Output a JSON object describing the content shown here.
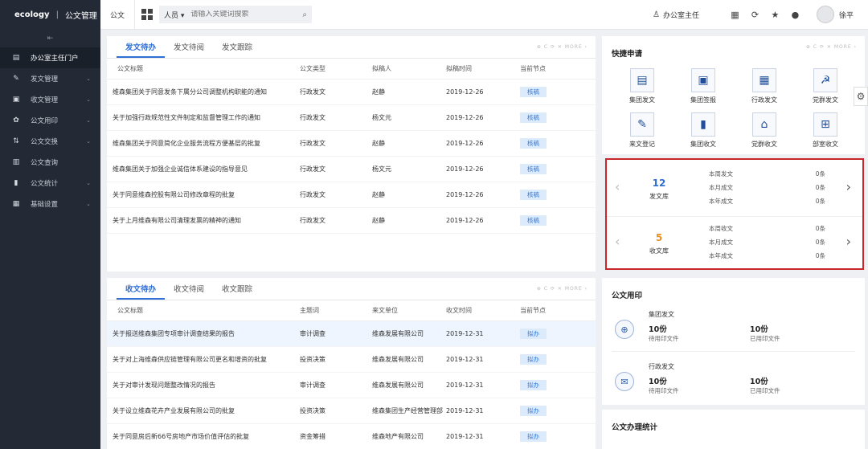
{
  "sidebar": {
    "brand": "ecology",
    "brand_sep": "|",
    "module": "公文管理",
    "collapse": "⇤",
    "items": [
      {
        "label": "办公室主任门户",
        "icon": "▤",
        "chev": "",
        "active": true
      },
      {
        "label": "发文管理",
        "icon": "✎",
        "chev": "⌄",
        "active": false
      },
      {
        "label": "收文管理",
        "icon": "▣",
        "chev": "⌄",
        "active": false
      },
      {
        "label": "公文用印",
        "icon": "✿",
        "chev": "⌄",
        "active": false
      },
      {
        "label": "公文交换",
        "icon": "⇅",
        "chev": "⌄",
        "active": false
      },
      {
        "label": "公文查询",
        "icon": "▥",
        "chev": "",
        "active": false
      },
      {
        "label": "公文统计",
        "icon": "▮",
        "chev": "⌄",
        "active": false
      },
      {
        "label": "基础设置",
        "icon": "▦",
        "chev": "⌄",
        "active": false
      }
    ]
  },
  "topbar": {
    "module": "公文",
    "search_type": "人员 ▾",
    "search_placeholder": "请输入关键词搜索",
    "search_icon": "⌕",
    "role_icon": "♙",
    "role": "办公室主任",
    "icons": [
      "▦",
      "⟳",
      "★",
      "●"
    ],
    "username": "徐平"
  },
  "tools_text": "⊕ C ⟳ ✕ MORE ›",
  "send_panel": {
    "tabs": [
      "发文待办",
      "发文待阅",
      "发文跟踪"
    ],
    "headers": [
      "公文标题",
      "公文类型",
      "拟稿人",
      "拟稿时间",
      "当前节点"
    ],
    "rows": [
      {
        "title": "维森集团关于同意发条下属分公司调整机构职能的通知",
        "type": "行政发文",
        "person": "赵静",
        "date": "2019-12-26",
        "node": "核稿"
      },
      {
        "title": "关于加强行政规范性文件制定和监督管理工作的通知",
        "type": "行政发文",
        "person": "杨文元",
        "date": "2019-12-26",
        "node": "核稿"
      },
      {
        "title": "维森集团关于同意简化企业服务流程方便基层的批复",
        "type": "行政发文",
        "person": "赵静",
        "date": "2019-12-26",
        "node": "核稿"
      },
      {
        "title": "维森集团关于加强企业诚信体系建设的指导意见",
        "type": "行政发文",
        "person": "杨文元",
        "date": "2019-12-26",
        "node": "核稿"
      },
      {
        "title": "关于同意维森控股有限公司修改章程的批复",
        "type": "行政发文",
        "person": "赵静",
        "date": "2019-12-26",
        "node": "核稿"
      },
      {
        "title": "关于上月维森有限公司清理发票的精神的通知",
        "type": "行政发文",
        "person": "赵静",
        "date": "2019-12-26",
        "node": "核稿"
      }
    ]
  },
  "recv_panel": {
    "tabs": [
      "收文待办",
      "收文待阅",
      "收文跟踪"
    ],
    "headers": [
      "公文标题",
      "主题词",
      "来文单位",
      "收文时间",
      "当前节点"
    ],
    "rows": [
      {
        "title": "关于报送维森集团专项审计调查结果的报告",
        "topic": "审计调查",
        "unit": "维森发展有限公司",
        "date": "2019-12-31",
        "node": "拟办"
      },
      {
        "title": "关于对上海维森供应链管理有限公司更名和增资的批复",
        "topic": "投资决策",
        "unit": "维森发展有限公司",
        "date": "2019-12-31",
        "node": "拟办"
      },
      {
        "title": "关于对审计发现问题整改情况的报告",
        "topic": "审计调查",
        "unit": "维森发展有限公司",
        "date": "2019-12-31",
        "node": "拟办"
      },
      {
        "title": "关于设立维森花卉产业发展有限公司的批复",
        "topic": "投资决策",
        "unit": "维森集团生产经营管理部",
        "date": "2019-12-31",
        "node": "拟办"
      },
      {
        "title": "关于同意房后新66号房地产市场价值评估的批复",
        "topic": "资金筹措",
        "unit": "维森地产有限公司",
        "date": "2019-12-31",
        "node": "拟办"
      }
    ]
  },
  "quick": {
    "title": "快捷申请",
    "items": [
      {
        "label": "集团发文",
        "icon": "▤"
      },
      {
        "label": "集团签报",
        "icon": "▣"
      },
      {
        "label": "行政发文",
        "icon": "▦"
      },
      {
        "label": "党群发文",
        "icon": "☭"
      },
      {
        "label": "来文登记",
        "icon": "✎"
      },
      {
        "label": "集团收文",
        "icon": "▮"
      },
      {
        "label": "党群收文",
        "icon": "⌂"
      },
      {
        "label": "部室收文",
        "icon": "⊞"
      }
    ]
  },
  "library": {
    "blocks": [
      {
        "count": "12",
        "name": "发文库",
        "color": "#2f6fd6",
        "stats": [
          {
            "label": "本周发文",
            "value": "0条"
          },
          {
            "label": "本月成文",
            "value": "0条"
          },
          {
            "label": "本年成文",
            "value": "0条"
          }
        ]
      },
      {
        "count": "5",
        "name": "收文库",
        "color": "#e6912a",
        "stats": [
          {
            "label": "本周收文",
            "value": "0条"
          },
          {
            "label": "本月成文",
            "value": "0条"
          },
          {
            "label": "本年成文",
            "value": "0条"
          }
        ]
      }
    ],
    "prev": "‹",
    "next": "›"
  },
  "usage": {
    "title": "公文用印",
    "groups": [
      {
        "category": "集团发文",
        "icon": "⊕",
        "left_num": "10份",
        "left_label": "待用印文件",
        "right_num": "10份",
        "right_label": "已用印文件"
      },
      {
        "category": "行政发文",
        "icon": "✉",
        "left_num": "10份",
        "left_label": "待用印文件",
        "right_num": "10份",
        "right_label": "已用印文件"
      }
    ]
  },
  "stats_panel": {
    "title": "公文办理统计"
  },
  "settings_icon": "⚙"
}
